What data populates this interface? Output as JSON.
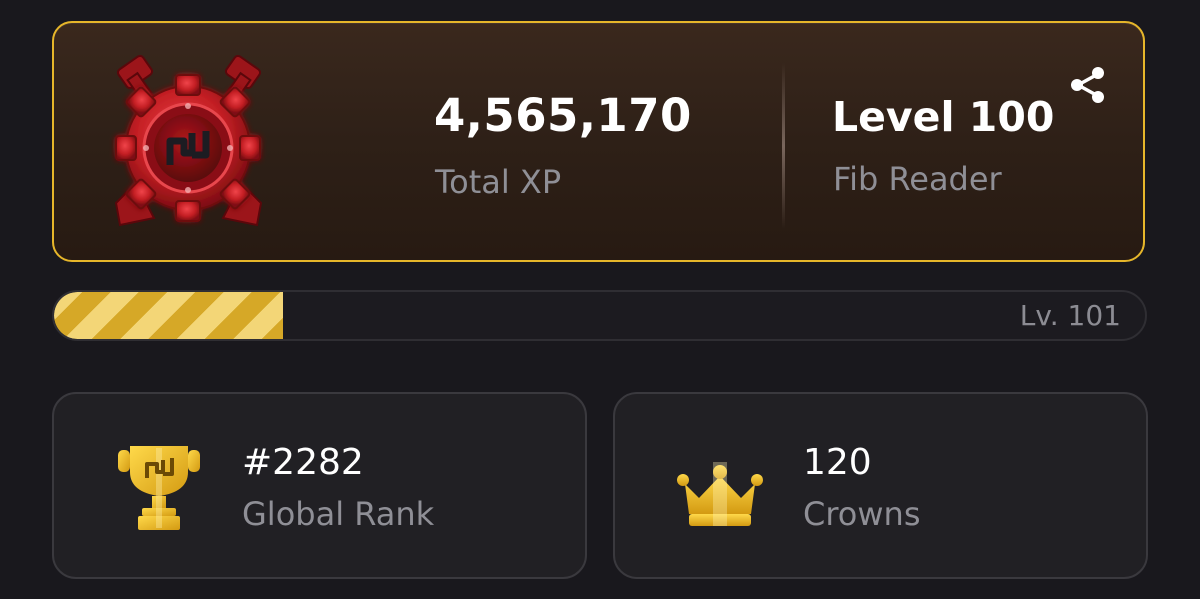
{
  "level_card": {
    "total_xp": "4,565,170",
    "total_xp_label": "Total XP",
    "level": "Level 100",
    "level_name": "Fib Reader",
    "badge_icon": "gear-hammer-badge-icon",
    "share_icon": "share-icon"
  },
  "progress": {
    "next_level_label": "Lv. 101",
    "fraction": 0.21,
    "stripe_colors": [
      "#f3d677",
      "#d6a827"
    ]
  },
  "stats": {
    "rank": {
      "value": "#2282",
      "label": "Global Rank",
      "icon": "trophy-icon"
    },
    "crowns": {
      "value": "120",
      "label": "Crowns",
      "icon": "crown-icon"
    }
  },
  "colors": {
    "accent_gold": "#e6b62a",
    "badge_red": "#c41f24",
    "background": "#19181d"
  }
}
